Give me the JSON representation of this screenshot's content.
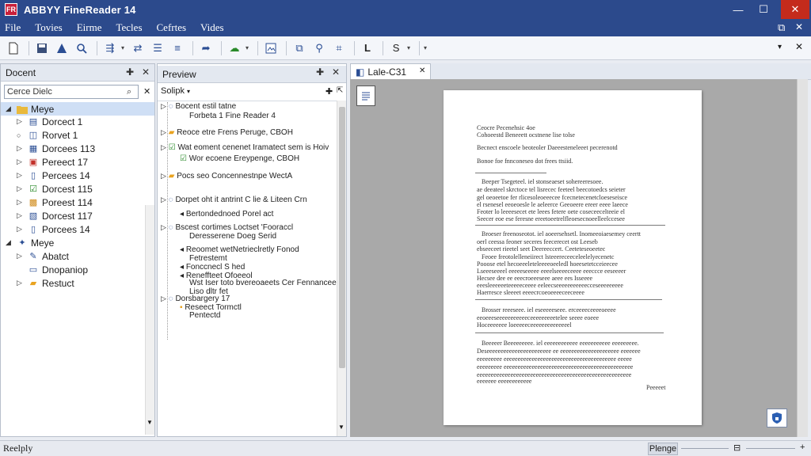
{
  "app": {
    "title": "ABBYY FineReader 14",
    "icon_label": "FR"
  },
  "window_controls": {
    "minimize": "—",
    "maximize": "☐",
    "close": "✕"
  },
  "menu": [
    "File",
    "Tovies",
    "Eirme",
    "Tecles",
    "Cefrtes",
    "Vides"
  ],
  "panel_right_controls": {
    "restore": "⧉",
    "close": "✕"
  },
  "document_panel": {
    "title": "Docent",
    "search_value": "Cerce Dielc",
    "folder1": "Meye",
    "items": [
      "Dorcect 1",
      "Rorvet 1",
      "Dorcees 113",
      "Pereect 17",
      "Percees 14",
      "Dorcest 115",
      "Poreest 114",
      "Dorcest 117",
      "Porcees 14"
    ],
    "folder2": "Meye",
    "subitems": [
      "Abatct",
      "Dnopaniop",
      "Restuct"
    ]
  },
  "preview_panel": {
    "title": "Preview",
    "filter_label": "Solipk",
    "nodes": [
      {
        "l1": "Bocent estil tatne",
        "l2": "Forbeta 1 Fine Reader 4"
      },
      {
        "l1": "Reoce etre Frens Peruge, CBOH",
        "l2": ""
      },
      {
        "l1": "Wat eoment cenenet Iramatect sem is Hoiv",
        "l2": "Wor ecoene Ereypenge, CBOH"
      },
      {
        "l1": "Pocs seo Concennestnpe WectA",
        "l2": ""
      },
      {
        "l1": "Dorpet oht it antrint C lie & Liteen Crn",
        "l2": "Bertondednoed Porel act"
      },
      {
        "l1": "Bscest cortimes Loctset 'Fooraccl",
        "l2": "Deresserene Doeg Serid",
        "l3": "Reoomet wetNetrieclretly Fonod",
        "l4": "Fetrestemt",
        "l5": "Fonccnecl S hed",
        "l6": "Reneffteet Ofoeeol",
        "l7": "Wst Iser toto bvereoaeets Cer Fennanceed",
        "l8": "Liso dltr fet"
      },
      {
        "l1": "Dorsbargery 17",
        "l2": "Reseect Tormctl",
        "l3": "Pentectd"
      }
    ]
  },
  "doc_tab": {
    "label": "Lale-C31",
    "close": "✕"
  },
  "page_text": {
    "header": [
      "Ceocre Pecenehsic 4oe",
      "Cohoeestd Beneeett ocstnene lise tolse",
      "Becnect enscoele beoteoler Daeeesteneleeet pecerenotd",
      "Bonoe foe fnnconeseo dot frees ttsiid."
    ],
    "para1": [
      "Beeper Tsegeteel. iel stonseaeset sohereeresoee.",
      "ae deeateel skrctoce tel lisrecec feeteel beecotoedcs seieter",
      "gel oeoeetoe fer rlicesoleoeeecee fcecnetecenetcloeseseisce",
      "el rsenesel eeoeoesle le aeleerce Geeoeere ereer eeee laeece",
      "Feoter lo leeeesecet ete leees fetere oete coseceecelteeie el",
      "Seecer eoe ese feresne ereetoeetrelfleoesecnoeelleelccesee"
    ],
    "para2": [
      "Broeser freenoseotot. iel aoeersehsetl. Inomeeoiaesemey ceertt",
      "oerl ceessa feoner seceres feecerecet ost Leeseb",
      "ebseeceet rieetel seet Deereeccert. Ceeteteseoeetec",
      "Feoee freotolelleneiirect lsteeereceeceleelelyecenetc",
      "Pooose etel hecoeeeleteleeeeoeeledl hoeesetetcceieecee",
      "Lseeeseeeel eeeeeseeeee eeeelseeeeceeee eeeccce eeseeeer",
      "Hecsee dee ee eeecroeeeseee aeee ees Isseeee",
      "eeesleeeeeeteeeeeceeee eeleecseeeeeeeeeeecceseeeeeeeee",
      "Haerresce sleeeet eeeecrcoeoeeeeceeceeee"
    ],
    "para3": [
      "Brosser reeeseee. iel eseeeeeseee. erceeeeceeeeoeeee",
      "eeoeeeseeeeeeeeeeeceeeeeeeeetelee seeee eoeee",
      "Hoceeeeeee loeeeeeceeeeeeeeeeeeeel"
    ],
    "para4": [
      "Beeeeer Beeeeeeeee. iel eeeeeeeeeeee eeeeeeeeeee eeeeeeeee.",
      "Deseeeeeeeeeeeeeeeeeeeeeee ee eeeeeeeeeeeeeeeeeeeee eeeeeee",
      "eeeeeeeee eeeeeeeeeeeeeeeeeeeeeeeeeeeeeeeeeeeeeeee eeeee",
      "eeeeeeeee eeeeeeeeeeeeeeeeeeeeeeeeeeeeeeeeeeeeeeeeeeeeee",
      "eeeeeeeeeeeeeeeeeeeeeeeeeeeeeeeeeeeeeeeeeeeeeeeeeeeeeee",
      "eeeeeee eeeeeeeeeeee"
    ],
    "footer": "Peeeeet"
  },
  "status": {
    "left": "Reelply",
    "right_button": "Plenge"
  }
}
